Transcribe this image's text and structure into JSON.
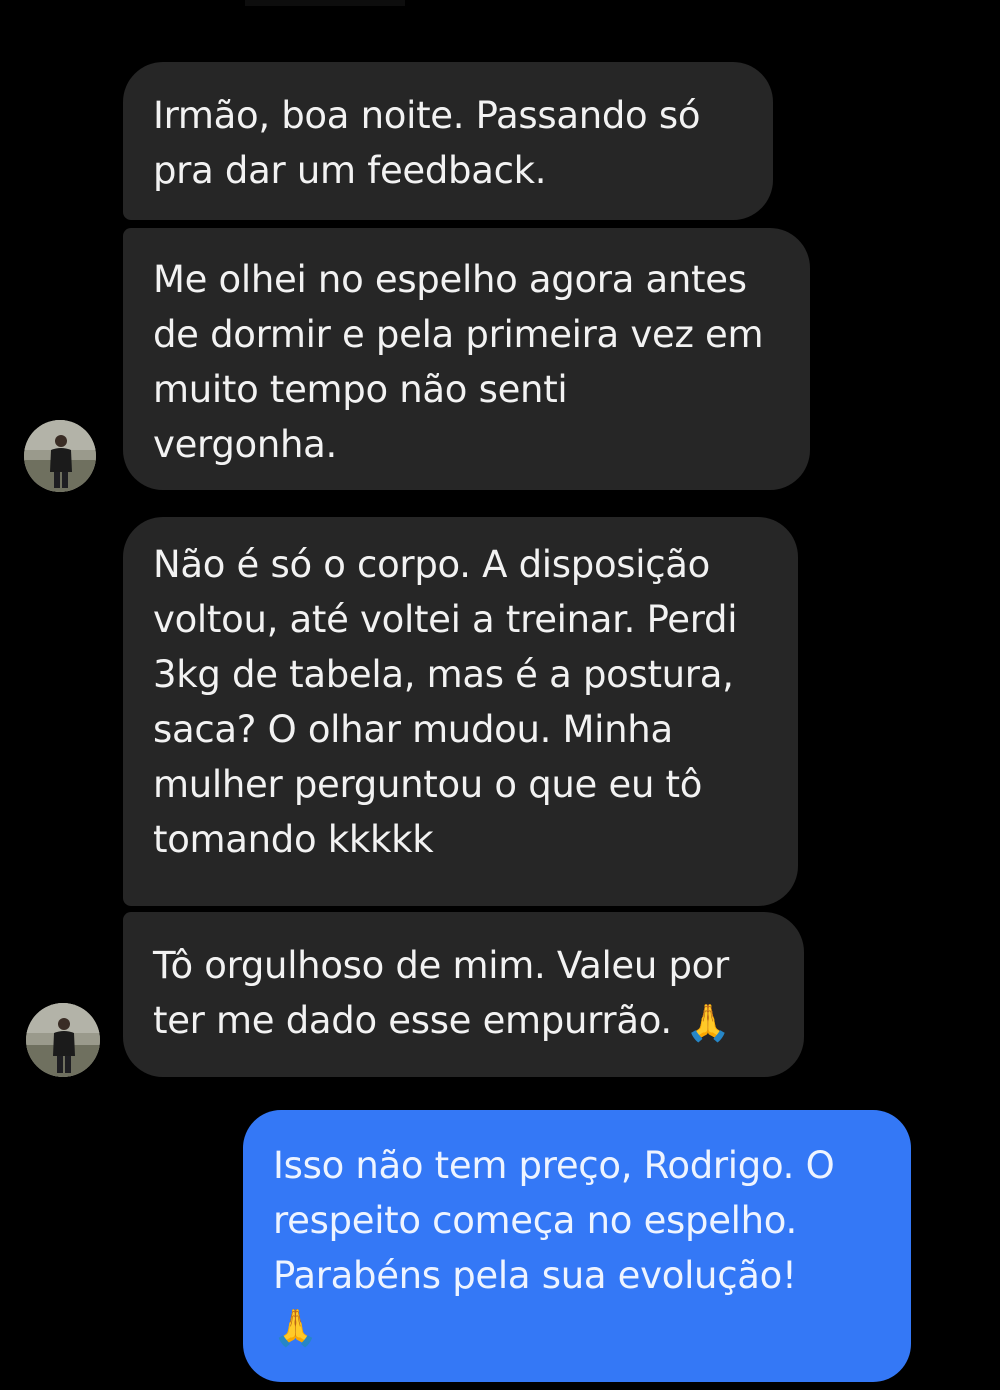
{
  "conversation": {
    "contact_name": "Rodrigo",
    "messages": [
      {
        "direction": "incoming",
        "text": "Irmão, boa noite. Passando só\npra dar um feedback."
      },
      {
        "direction": "incoming",
        "text": "Me olhei no espelho agora antes\nde dormir e pela primeira vez em\nmuito tempo não senti\nvergonha."
      },
      {
        "direction": "incoming",
        "text": "Não é só o corpo. A disposição\nvoltou, até voltei a treinar. Perdi\n3kg de tabela, mas é a postura,\nsaca? O olhar mudou. Minha\nmulher perguntou o que eu tô\ntomando kkkkk"
      },
      {
        "direction": "incoming",
        "text": "Tô orgulhoso de mim. Valeu por\nter me dado esse empurrão.",
        "emoji": "🙏"
      },
      {
        "direction": "outgoing",
        "text": "Isso não tem preço, Rodrigo. O\nrespeito começa no espelho.\nParabéns pela sua evolução!",
        "emoji": "🙏"
      }
    ]
  },
  "colors": {
    "background": "#000000",
    "incoming_bubble": "#262626",
    "outgoing_bubble": "#3478f6",
    "text": "#f2f2f2"
  },
  "icons": {
    "avatar": "contact-avatar-photo",
    "emoji": "folded-hands-emoji"
  }
}
